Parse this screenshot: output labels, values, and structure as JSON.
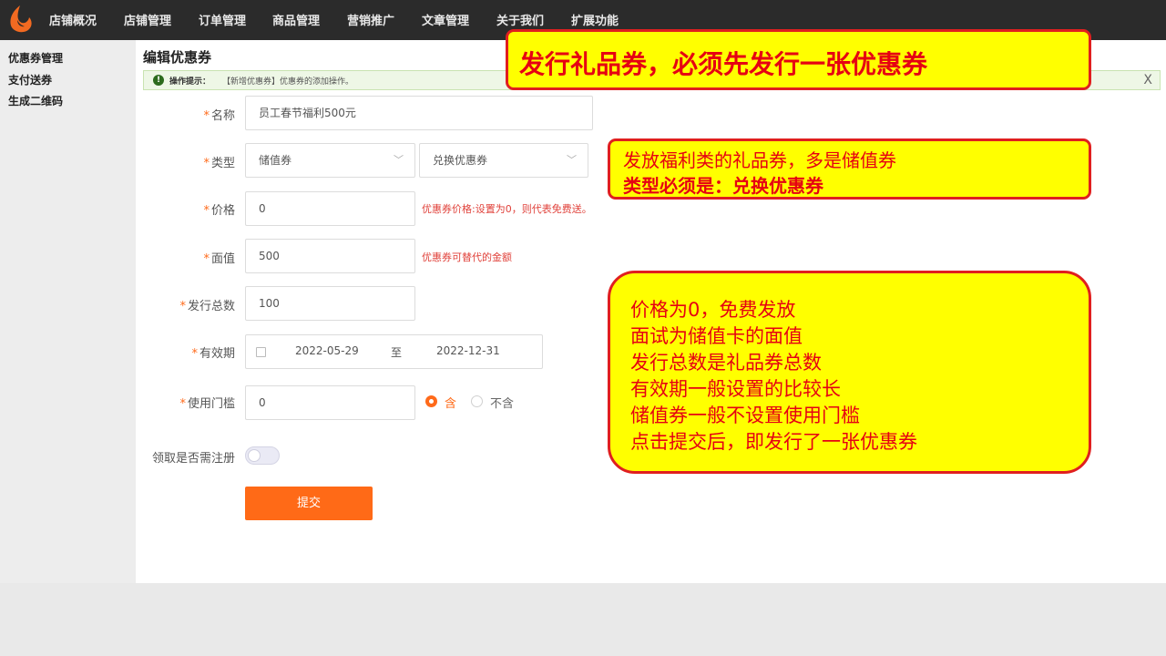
{
  "colors": {
    "accent": "#ff6a17",
    "topbar": "#2b2b2b",
    "callout_bg": "#ffff00",
    "callout_text": "#e60012",
    "hint": "#e0413a"
  },
  "topnav": {
    "items": [
      "店铺概况",
      "店铺管理",
      "订单管理",
      "商品管理",
      "营销推广",
      "文章管理",
      "关于我们",
      "扩展功能"
    ]
  },
  "sidebar": {
    "items": [
      "优惠券管理",
      "支付送券",
      "生成二维码"
    ]
  },
  "page": {
    "title": "编辑优惠券",
    "tip_label": "操作提示：",
    "tip_text": "【新增优惠券】优惠券的添加操作。",
    "tip_close": "X"
  },
  "form": {
    "required_mark": "*",
    "name": {
      "label": "名称",
      "value": "员工春节福利500元"
    },
    "type": {
      "label": "类型",
      "value1": "储值券",
      "value2": "兑换优惠券"
    },
    "price": {
      "label": "价格",
      "value": "0",
      "hint": "优惠券价格:设置为0，则代表免费送。"
    },
    "face": {
      "label": "面值",
      "value": "500",
      "hint": "优惠券可替代的金额"
    },
    "total": {
      "label": "发行总数",
      "value": "100"
    },
    "validity": {
      "label": "有效期",
      "start": "2022-05-29",
      "sep": "至",
      "end": "2022-12-31"
    },
    "threshold": {
      "label": "使用门槛",
      "value": "0",
      "opt_include": "含",
      "opt_exclude": "不含"
    },
    "register": {
      "label": "领取是否需注册",
      "enabled": false
    },
    "submit": "提交"
  },
  "callouts": {
    "title": "发行礼品券，必须先发行一张优惠券",
    "type_line1": "发放福利类的礼品券，多是储值券",
    "type_line2": "类型必须是：兑换优惠券",
    "notes": [
      "价格为0，免费发放",
      "面试为储值卡的面值",
      "发行总数是礼品券总数",
      "有效期一般设置的比较长",
      "储值券一般不设置使用门槛",
      "点击提交后，即发行了一张优惠券"
    ]
  }
}
